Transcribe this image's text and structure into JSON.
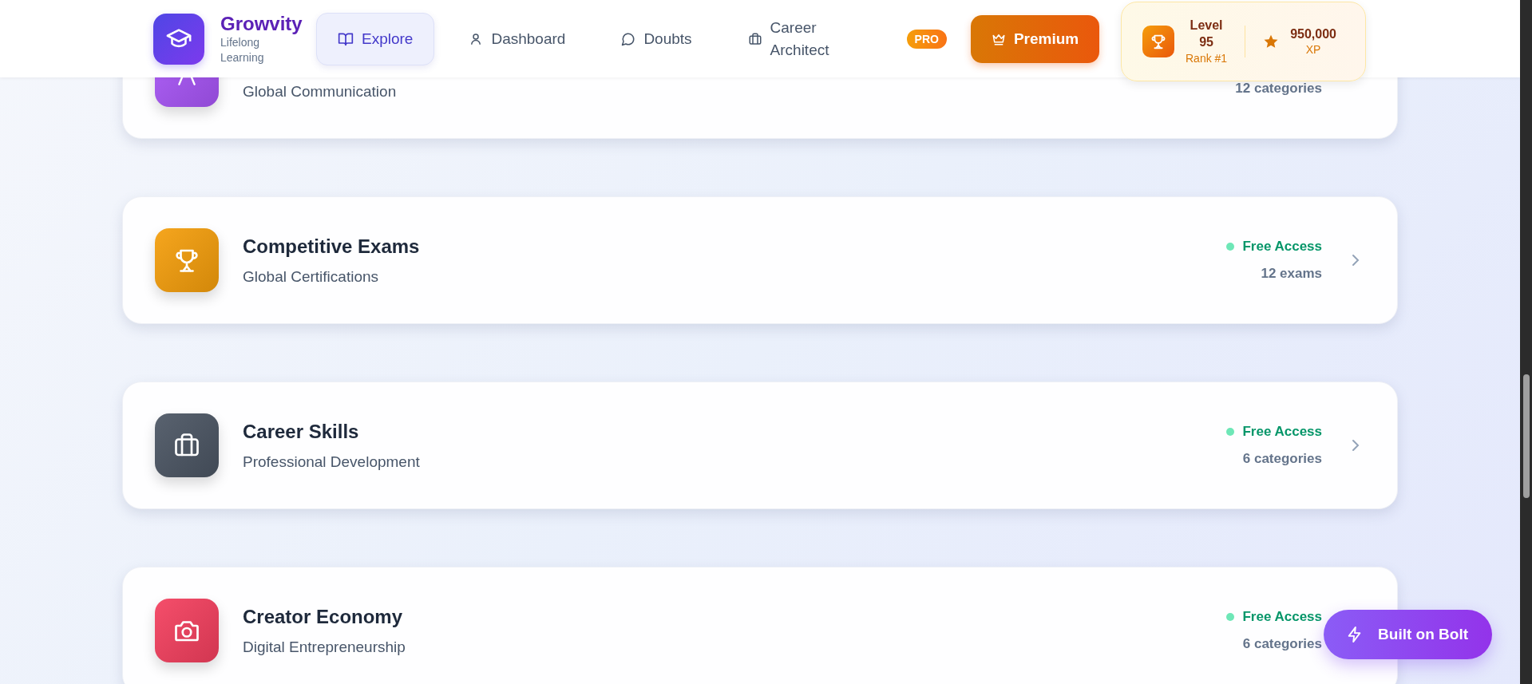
{
  "brand": {
    "name": "Growvity",
    "tagline": "Lifelong Learning"
  },
  "nav": [
    {
      "label": "Explore",
      "kind": "book",
      "selected": true
    },
    {
      "label": "Dashboard",
      "kind": "user",
      "selected": false
    },
    {
      "label": "Doubts",
      "kind": "chat",
      "selected": false
    },
    {
      "label": "Career Architect",
      "kind": "briefcase",
      "selected": false
    }
  ],
  "pro_badge": "PRO",
  "premium_button": "Premium",
  "level_panel": {
    "level_label": "Level",
    "level_value": "95",
    "rank": "Rank #1",
    "xp": "950,000",
    "xp_label": "XP"
  },
  "cards": [
    {
      "kind": "language",
      "color": "#a855f7",
      "subtitle": "Global Communication",
      "count": "12 categories"
    },
    {
      "kind": "trophy",
      "color": "#f59e0b",
      "title": "Competitive Exams",
      "subtitle": "Global Certifications",
      "access": "Free Access",
      "count": "12 exams",
      "chevron": true
    },
    {
      "kind": "briefcase",
      "color": "#4b5563",
      "title": "Career Skills",
      "subtitle": "Professional Development",
      "access": "Free Access",
      "count": "6 categories",
      "chevron": true
    },
    {
      "kind": "camera",
      "color": "#f43f5e",
      "title": "Creator Economy",
      "subtitle": "Digital Entrepreneurship",
      "access": "Free Access",
      "count": "6 categories"
    }
  ],
  "bolt_button": "Built on Bolt"
}
